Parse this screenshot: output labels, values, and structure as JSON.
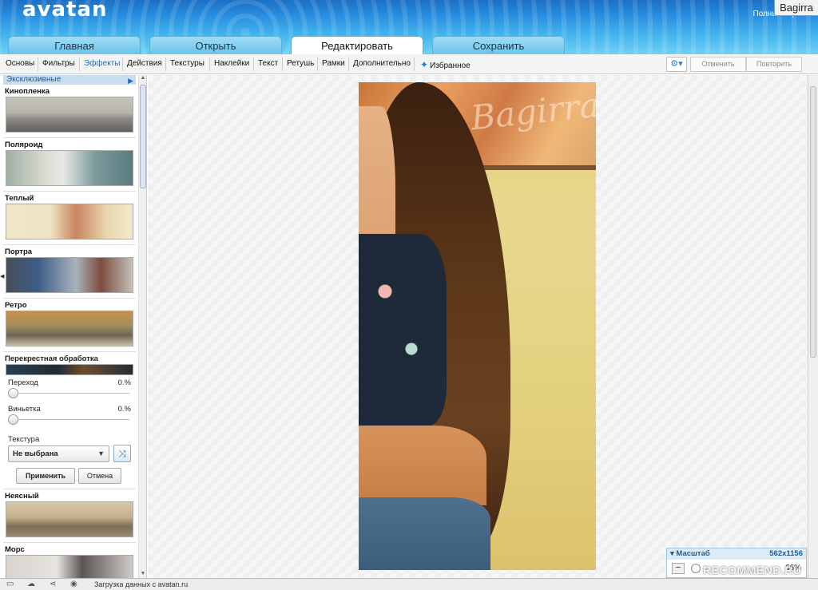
{
  "app": {
    "logo": "avatan",
    "fullscreen_label": "Полный экран",
    "user_tag": "Bagirra"
  },
  "tabs": [
    {
      "label": "Главная",
      "active": false
    },
    {
      "label": "Открыть",
      "active": false
    },
    {
      "label": "Редактировать",
      "active": true
    },
    {
      "label": "Сохранить",
      "active": false
    }
  ],
  "toolbar": {
    "items": [
      "Основы",
      "Фильтры",
      "Эффекты",
      "Действия",
      "Текстуры",
      "Наклейки",
      "Текст",
      "Ретушь",
      "Рамки",
      "Дополнительно"
    ],
    "active_item": "Эффекты",
    "favorites": "Избранное",
    "undo": "Отменить",
    "redo": "Повторить"
  },
  "left_panel": {
    "section": "Эксклюзивные",
    "effects": [
      "Кинопленка",
      "Поляроид",
      "Теплый",
      "Портра",
      "Ретро"
    ],
    "cross": {
      "name": "Перекрестная обработка",
      "transition_label": "Переход",
      "transition_value": "0.%",
      "vignette_label": "Виньетка",
      "vignette_value": "0.%",
      "texture_label": "Текстура",
      "texture_value": "Не выбрана",
      "apply": "Применить",
      "cancel": "Отмена"
    },
    "effects_after": [
      "Неясный",
      "Морс"
    ]
  },
  "photo": {
    "watermark": "Bagirra"
  },
  "zoom": {
    "title": "Масштаб",
    "size": "562x1156",
    "value": "66%"
  },
  "status": {
    "text": "Загрузка данных с avatan.ru"
  },
  "watermark_bottom": "RECOMMEND.RU",
  "colors": {
    "accent": "#1a6fc4",
    "header_top": "#1a6fc4",
    "header_bottom": "#6fd0f3"
  }
}
